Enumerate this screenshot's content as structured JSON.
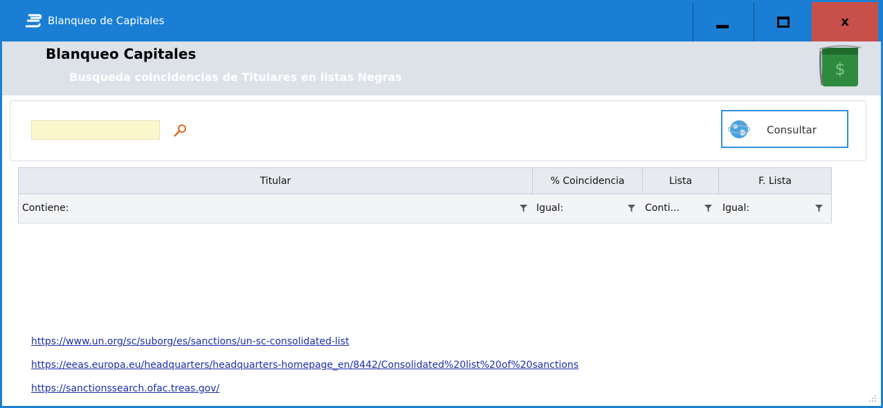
{
  "window": {
    "title": "Blanqueo de Capitales",
    "controls": {
      "minimize": "minimize",
      "maximize": "maximize",
      "close_glyph": "x"
    },
    "colors": {
      "titlebar": "#1a7fd4",
      "close": "#c7504b"
    }
  },
  "header": {
    "title": "Blanqueo Capitales",
    "subtitle": "Busqueda coincidencias de Titulares en listas Negras",
    "icon": "money-bag-icon"
  },
  "search": {
    "value": "",
    "placeholder": "",
    "icon": "search-icon",
    "consult_label": "Consultar",
    "consult_icon": "globe-icon"
  },
  "grid": {
    "columns": [
      {
        "header": "Titular",
        "filter": "Contiene:"
      },
      {
        "header": "% Coincidencia",
        "filter": "Igual:"
      },
      {
        "header": "Lista",
        "filter": "Conti..."
      },
      {
        "header": "F. Lista",
        "filter": "Igual:"
      }
    ],
    "rows": []
  },
  "links": [
    "https://www.un.org/sc/suborg/es/sanctions/un-sc-consolidated-list",
    "https://eeas.europa.eu/headquarters/headquarters-homepage_en/8442/Consolidated%20list%20of%20sanctions",
    "https://sanctionssearch.ofac.treas.gov/"
  ]
}
